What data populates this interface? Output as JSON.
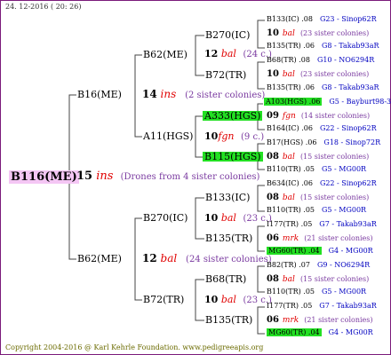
{
  "date": "24. 12-2016 ( 20: 26)",
  "footer": "Copyright 2004-2016 @ Karl Kehrle Foundation.   www.pedigreeapis.org",
  "root": {
    "label": "B116(ME)",
    "num": "15",
    "ins": "ins",
    "note": "(Drones from 4 sister colonies)"
  },
  "l1": [
    {
      "label": "B16(ME)",
      "num": "14",
      "ins": "ins",
      "note": "(2 sister colonies)"
    },
    {
      "label": "B62(ME)",
      "num": "12",
      "ins": "bal",
      "note": "(24 sister colonies)"
    }
  ],
  "l2": [
    {
      "label": "B62(ME)"
    },
    {
      "label": "A11(HGS)",
      "num": "10",
      "ins": "fgn",
      "note": "(9 c.)"
    },
    {
      "label": "B270(IC)",
      "num": "10",
      "ins": "bal",
      "note": "(23 c.)"
    },
    {
      "label": "B72(TR)",
      "num": "10",
      "ins": "bal",
      "note": "(23 c.)"
    }
  ],
  "l3": [
    {
      "label": "B270(IC)"
    },
    {
      "label": "B72(TR)"
    },
    {
      "label": "A333(HGS)"
    },
    {
      "label": "B115(HGS)"
    },
    {
      "label": "B133(IC)"
    },
    {
      "label": "B135(TR)"
    },
    {
      "label": "B68(TR)"
    },
    {
      "label": "B135(TR)"
    }
  ],
  "l3_mid": [
    {
      "num": "12",
      "ins": "bal",
      "note": "(24 c.)"
    }
  ],
  "l4": [
    {
      "left": "B133(IC) .08",
      "right": "G23 - Sinop62R"
    },
    {
      "num": "10",
      "ins": "bal",
      "note": "(23 sister colonies)"
    },
    {
      "left": "B135(TR) .06",
      "right": "G8 - Takab93aR"
    },
    {
      "left": "B68(TR) .08",
      "right": "G10 - NO6294R"
    },
    {
      "num": "10",
      "ins": "bal",
      "note": "(23 sister colonies)"
    },
    {
      "left": "B135(TR) .06",
      "right": "G8 - Takab93aR"
    },
    {
      "left": "A103(HGS) .06",
      "right": "G5 - Bayburt98-3"
    },
    {
      "num": "09",
      "ins": "fgn",
      "note": "(14 sister colonies)"
    },
    {
      "left": "B164(IC) .06",
      "right": "G22 - Sinop62R"
    },
    {
      "left": "B17(HGS) .06",
      "right": "G18 - Sinop72R"
    },
    {
      "num": "08",
      "ins": "bal",
      "note": "(15 sister colonies)"
    },
    {
      "left": "B110(TR) .05",
      "right": "G5 - MG00R"
    },
    {
      "left": "B634(IC) .06",
      "right": "G22 - Sinop62R"
    },
    {
      "num": "08",
      "ins": "bal",
      "note": "(15 sister colonies)"
    },
    {
      "left": "B110(TR) .05",
      "right": "G5 - MG00R"
    },
    {
      "left": "I177(TR) .05",
      "right": "G7 - Takab93aR"
    },
    {
      "num": "06",
      "ins": "mrk",
      "note": "(21 sister colonies)"
    },
    {
      "left": "MG60(TR) .04",
      "right": "G4 - MG00R"
    },
    {
      "left": "B82(TR) .07",
      "right": "G9 - NO6294R"
    },
    {
      "num": "08",
      "ins": "bal",
      "note": "(15 sister colonies)"
    },
    {
      "left": "B110(TR) .05",
      "right": "G5 - MG00R"
    },
    {
      "left": "I177(TR) .05",
      "right": "G7 - Takab93aR"
    },
    {
      "num": "06",
      "ins": "mrk",
      "note": "(21 sister colonies)"
    },
    {
      "left": "MG60(TR) .04",
      "right": "G4 - MG00R"
    }
  ],
  "colors": {
    "frame": "#7a1a7a",
    "highlight_pink": "#f4c6f4",
    "highlight_green": "#22e022",
    "ins": "#e00000",
    "note": "#7a3aa0",
    "gen": "#0000c0"
  }
}
